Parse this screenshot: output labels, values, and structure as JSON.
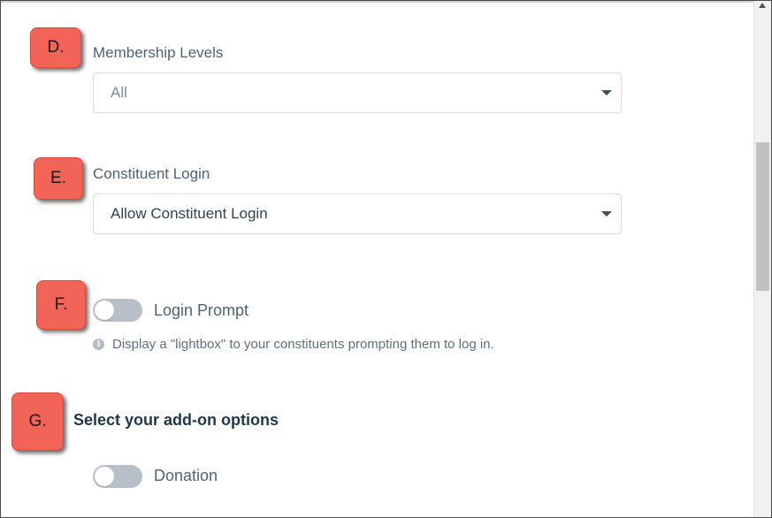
{
  "steps": {
    "d": "D.",
    "e": "E.",
    "f": "F.",
    "g": "G."
  },
  "membership": {
    "label": "Membership Levels",
    "value": "All"
  },
  "constituent_login": {
    "label": "Constituent Login",
    "value": "Allow Constituent Login"
  },
  "login_prompt": {
    "label": "Login Prompt",
    "enabled": false,
    "hint": "Display a \"lightbox\" to your constituents prompting them to log in."
  },
  "addons": {
    "heading": "Select your add-on options",
    "donation_label": "Donation",
    "donation_enabled": false
  },
  "colors": {
    "badge": "#f26457",
    "toggle_off": "#b7bfca",
    "label": "#4e6272",
    "heading": "#1e3847"
  }
}
